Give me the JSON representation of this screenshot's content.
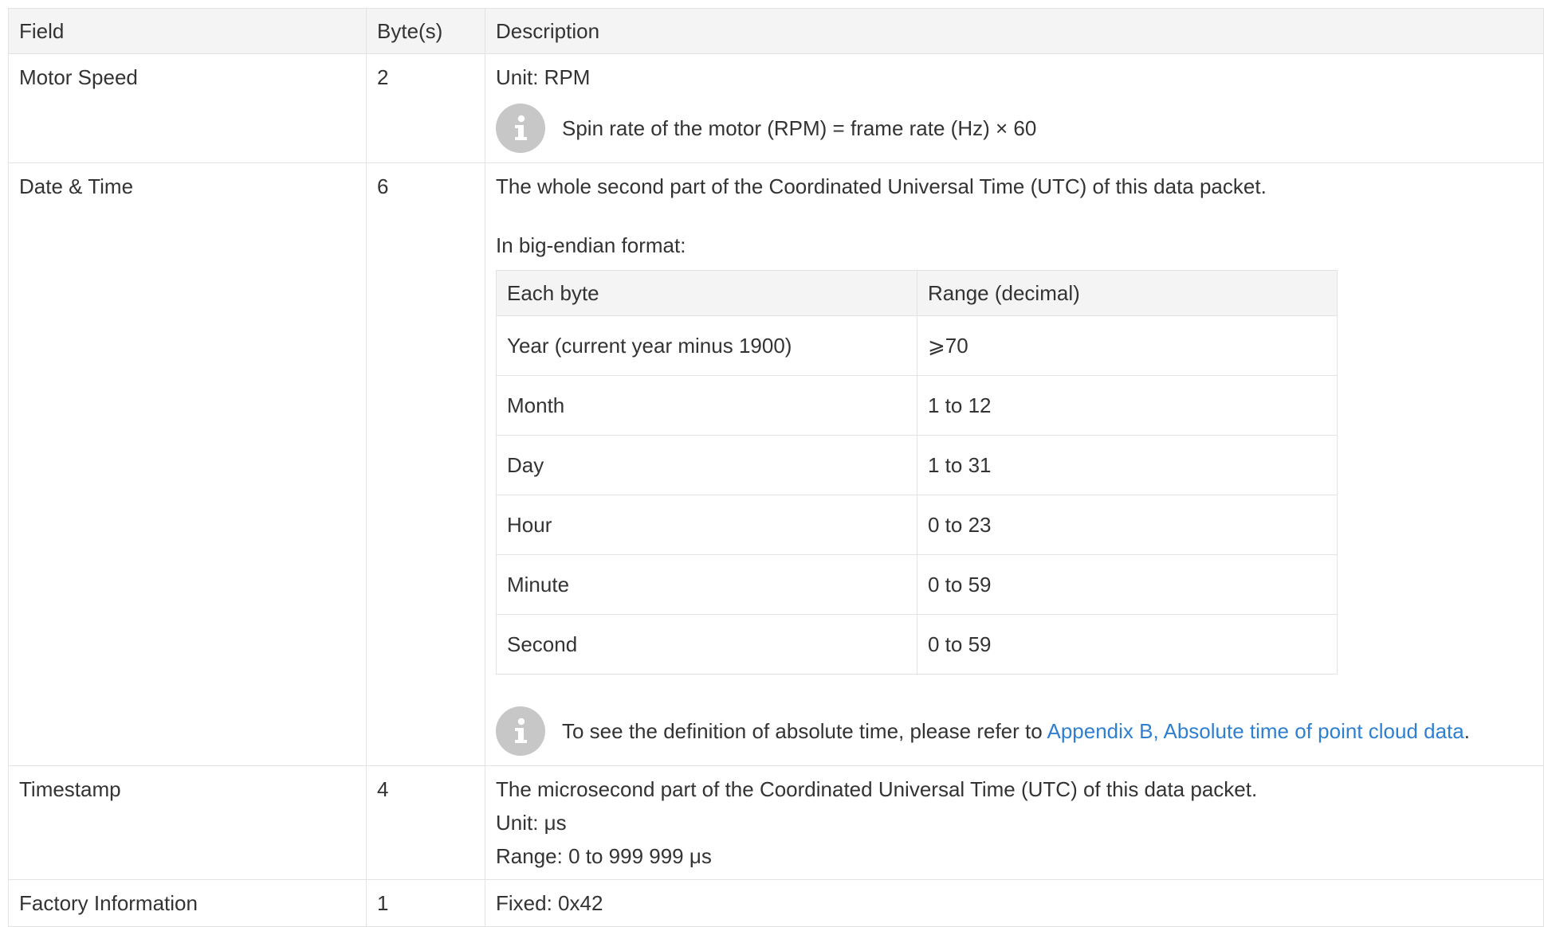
{
  "table": {
    "headers": {
      "field": "Field",
      "bytes": "Byte(s)",
      "description": "Description"
    },
    "rows": {
      "motor_speed": {
        "field": "Motor Speed",
        "bytes": "2",
        "unit": "Unit: RPM",
        "note": "Spin rate of the motor (RPM) = frame rate (Hz) × 60",
        "note_icon": "info-icon"
      },
      "date_time": {
        "field": "Date & Time",
        "bytes": "6",
        "desc1": "The whole second part of the Coordinated Universal Time (UTC) of this data packet.",
        "desc2": "In big-endian format:",
        "inner_headers": [
          "Each byte",
          "Range (decimal)"
        ],
        "inner_rows": [
          [
            "Year (current year minus 1900)",
            "⩾70"
          ],
          [
            "Month",
            "1 to 12"
          ],
          [
            "Day",
            "1 to 31"
          ],
          [
            "Hour",
            "0 to 23"
          ],
          [
            "Minute",
            "0 to 59"
          ],
          [
            "Second",
            "0 to 59"
          ]
        ],
        "note_prefix": "To see the definition of absolute time, please refer to ",
        "note_link": "Appendix B, Absolute time of point cloud data",
        "note_suffix": ".",
        "note_icon": "info-icon"
      },
      "timestamp": {
        "field": "Timestamp",
        "bytes": "4",
        "line1": "The microsecond part of the Coordinated Universal Time (UTC) of this data packet.",
        "line2": "Unit: μs",
        "line3": "Range: 0 to 999 999 μs"
      },
      "factory_info": {
        "field": "Factory Information",
        "bytes": "1",
        "desc": "Fixed: 0x42"
      }
    }
  },
  "colors": {
    "border": "#e3e3e3",
    "header_bg": "#f4f4f4",
    "text": "#333333",
    "link": "#2f7fd0",
    "info_icon_bg": "#c7c7c7"
  }
}
